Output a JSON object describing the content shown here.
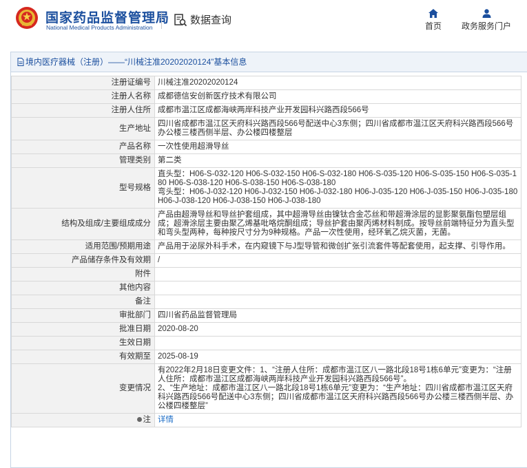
{
  "site": {
    "name_zh": "国家药品监督管理局",
    "name_en": "National Medical Products Administration",
    "query_label": "数据查询"
  },
  "nav": {
    "home": "首页",
    "services": "政务服务门户"
  },
  "panel": {
    "breadcrumb": "境内医疗器械（注册）——“川械注准20202020124”基本信息"
  },
  "rows": [
    {
      "label": "注册证编号",
      "value": "川械注准20202020124"
    },
    {
      "label": "注册人名称",
      "value": "成都德信安创新医疗技术有限公司"
    },
    {
      "label": "注册人住所",
      "value": "成都市温江区成都海峡两岸科技产业开发园科兴路西段566号"
    },
    {
      "label": "生产地址",
      "value": "四川省成都市温江区天府科兴路西段566号配送中心3东侧；四川省成都市温江区天府科兴路西段566号办公楼三楼西侧半层、办公楼四楼整层"
    },
    {
      "label": "产品名称",
      "value": "一次性使用超滑导丝"
    },
    {
      "label": "管理类别",
      "value": "第二类"
    },
    {
      "label": "型号规格",
      "value": "直头型：H06-S-032-120 H06-S-032-150 H06-S-032-180 H06-S-035-120 H06-S-035-150 H06-S-035-180 H06-S-038-120 H06-S-038-150 H06-S-038-180\n弯头型：H06-J-032-120 H06-J-032-150 H06-J-032-180 H06-J-035-120 H06-J-035-150 H06-J-035-180 H06-J-038-120 H06-J-038-150 H06-J-038-180"
    },
    {
      "label": "结构及组成/主要组成成分",
      "value": "产品由超滑导丝和导丝护套组成，其中超滑导丝由镍钛合金芯丝和带超滑涂层的显影聚氨酯包塑层组成；超滑涂层主要由聚乙烯基吡咯烷酮组成；导丝护套由聚丙烯材料制成。按导丝前端特征分为直头型和弯头型两种，每种按尺寸分为9种规格。产品一次性使用，经环氧乙烷灭菌，无菌。"
    },
    {
      "label": "适用范围/预期用途",
      "value": "产品用于泌尿外科手术，在内窥镜下与J型导管和微创扩张引流套件等配套使用，起支撑、引导作用。"
    },
    {
      "label": "产品储存条件及有效期",
      "value": "/"
    },
    {
      "label": "附件",
      "value": ""
    },
    {
      "label": "其他内容",
      "value": ""
    },
    {
      "label": "备注",
      "value": ""
    },
    {
      "label": "审批部门",
      "value": "四川省药品监督管理局"
    },
    {
      "label": "批准日期",
      "value": "2020-08-20"
    },
    {
      "label": "生效日期",
      "value": ""
    },
    {
      "label": "有效期至",
      "value": "2025-08-19"
    },
    {
      "label": "变更情况",
      "value": "有2022年2月18日变更文件：1、“注册人住所：成都市温江区八一路北段18号1栋6单元”变更为：“注册人住所：成都市温江区成都海峡两岸科技产业开发园科兴路西段566号”。\n2、“生产地址：成都市温江区八一路北段18号1栋6单元”变更为：“生产地址：四川省成都市温江区天府科兴路西段566号配送中心3东侧；四川省成都市温江区天府科兴路西段566号办公楼三楼西侧半层、办公楼四楼整层”"
    }
  ],
  "note": {
    "label": "注",
    "link": "详情"
  }
}
